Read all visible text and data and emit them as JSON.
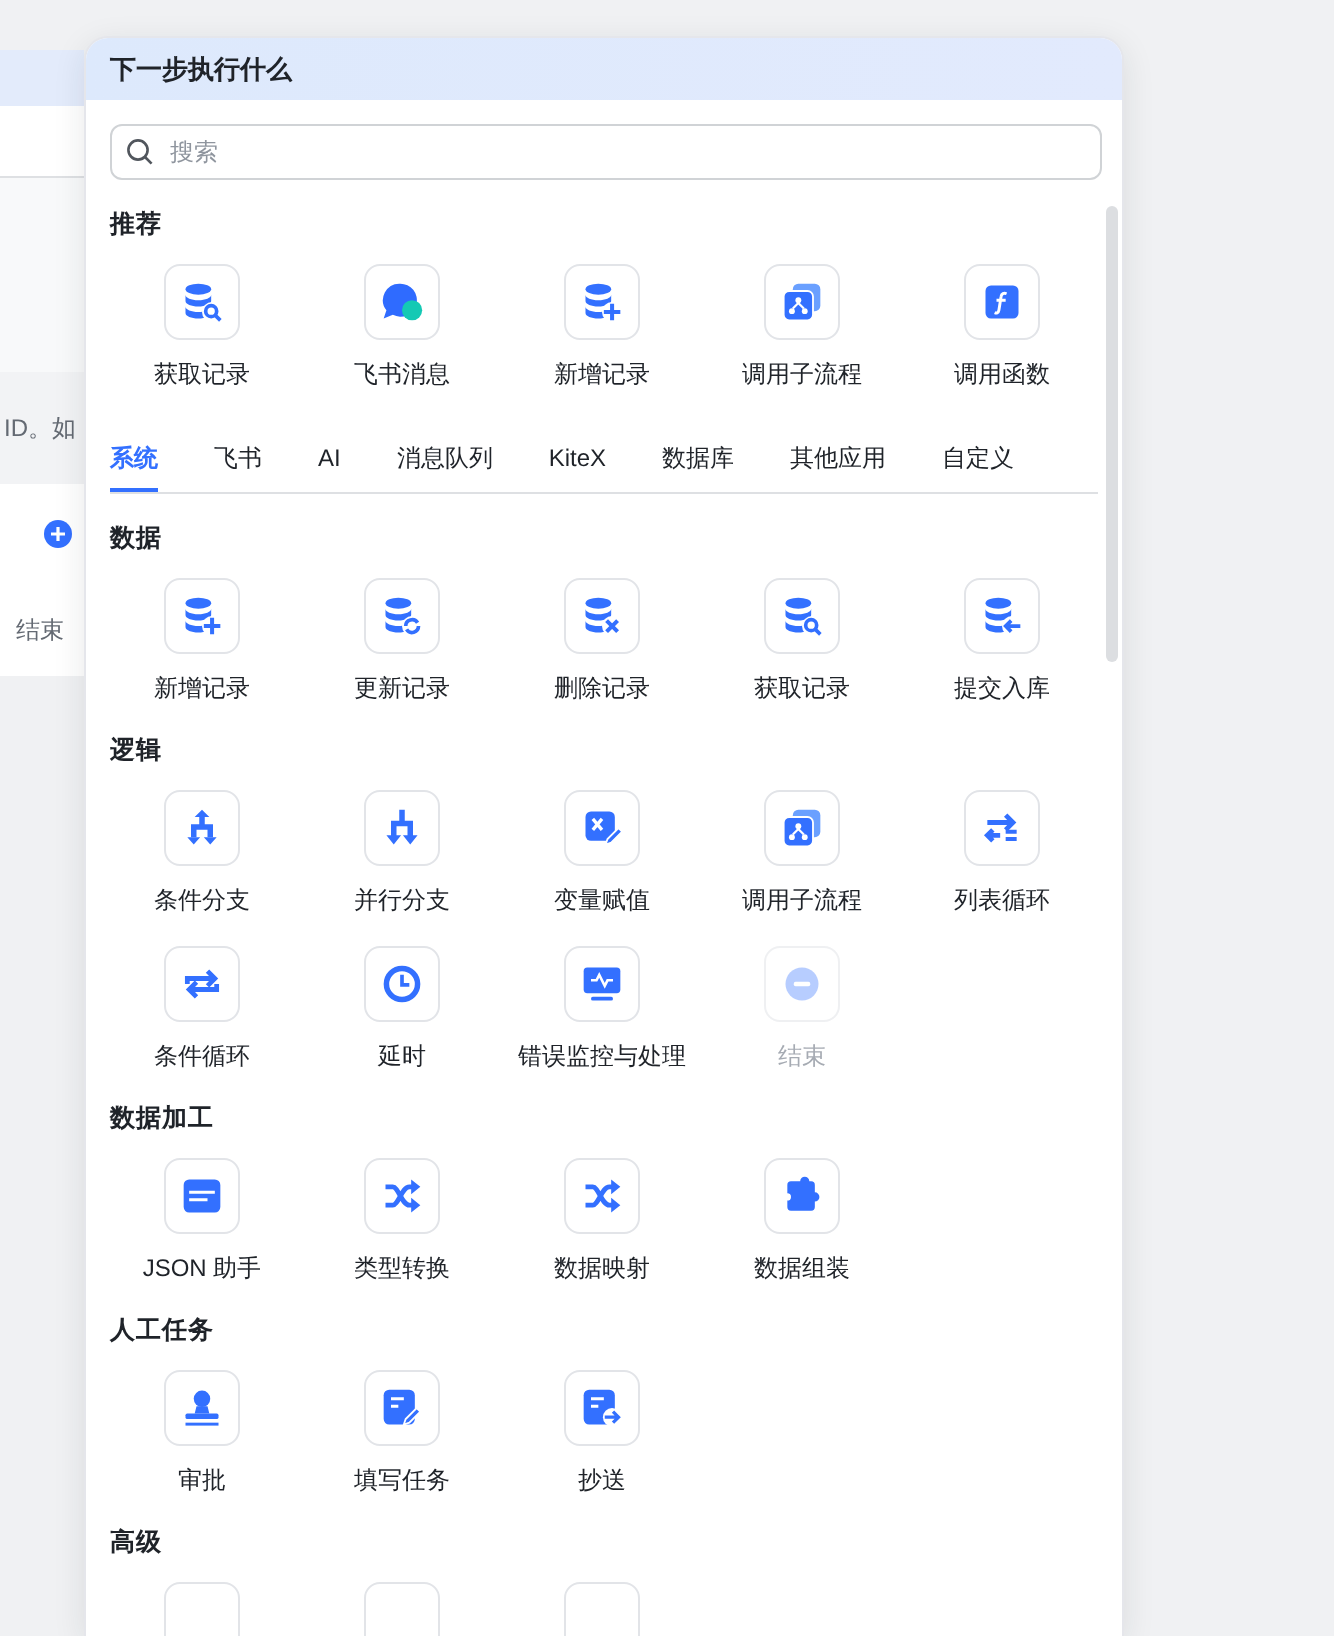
{
  "background": {
    "hint_text": "ID。如",
    "end_node_label": "结束"
  },
  "dialog": {
    "title": "下一步执行什么",
    "search": {
      "placeholder": "搜索"
    },
    "recommended": {
      "title": "推荐",
      "items": [
        {
          "label": "获取记录",
          "kind": "db-search"
        },
        {
          "label": "飞书消息",
          "kind": "chat"
        },
        {
          "label": "新增记录",
          "kind": "db-add"
        },
        {
          "label": "调用子流程",
          "kind": "subflow"
        },
        {
          "label": "调用函数",
          "kind": "function"
        }
      ]
    },
    "tabs": [
      {
        "label": "系统",
        "selected": true
      },
      {
        "label": "飞书",
        "selected": false
      },
      {
        "label": "AI",
        "selected": false
      },
      {
        "label": "消息队列",
        "selected": false
      },
      {
        "label": "KiteX",
        "selected": false
      },
      {
        "label": "数据库",
        "selected": false
      },
      {
        "label": "其他应用",
        "selected": false
      },
      {
        "label": "自定义",
        "selected": false
      }
    ],
    "sections": [
      {
        "title": "数据",
        "items": [
          {
            "label": "新增记录",
            "kind": "db-add"
          },
          {
            "label": "更新记录",
            "kind": "db-update"
          },
          {
            "label": "删除记录",
            "kind": "db-delete"
          },
          {
            "label": "获取记录",
            "kind": "db-search"
          },
          {
            "label": "提交入库",
            "kind": "db-import"
          }
        ]
      },
      {
        "title": "逻辑",
        "items": [
          {
            "label": "条件分支",
            "kind": "branch-condition",
            "disabled": false
          },
          {
            "label": "并行分支",
            "kind": "branch-parallel",
            "disabled": false
          },
          {
            "label": "变量赋值",
            "kind": "variable",
            "disabled": false
          },
          {
            "label": "调用子流程",
            "kind": "subflow",
            "disabled": false
          },
          {
            "label": "列表循环",
            "kind": "loop-list",
            "disabled": false
          },
          {
            "label": "条件循环",
            "kind": "loop",
            "disabled": false
          },
          {
            "label": "延时",
            "kind": "clock",
            "disabled": false
          },
          {
            "label": "错误监控与处理",
            "kind": "monitor",
            "disabled": false
          },
          {
            "label": "结束",
            "kind": "minus-circle",
            "disabled": true
          }
        ]
      },
      {
        "title": "数据加工",
        "items": [
          {
            "label": "JSON 助手",
            "kind": "json"
          },
          {
            "label": "类型转换",
            "kind": "shuffle"
          },
          {
            "label": "数据映射",
            "kind": "shuffle"
          },
          {
            "label": "数据组装",
            "kind": "puzzle"
          }
        ]
      },
      {
        "title": "人工任务",
        "items": [
          {
            "label": "审批",
            "kind": "stamp"
          },
          {
            "label": "填写任务",
            "kind": "form-edit"
          },
          {
            "label": "抄送",
            "kind": "form-send"
          }
        ]
      },
      {
        "title": "高级",
        "items": [
          {
            "kind": "hidden"
          },
          {
            "kind": "hidden"
          },
          {
            "kind": "hidden"
          }
        ]
      }
    ]
  }
}
